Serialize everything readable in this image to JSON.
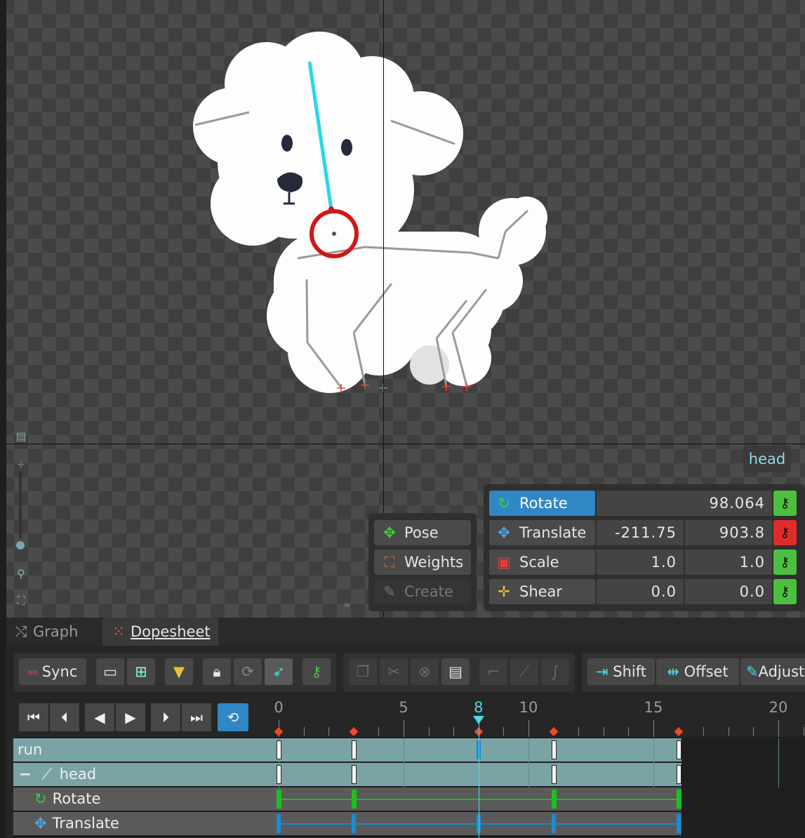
{
  "viewport": {
    "bone_label": "head",
    "tool_icons": [
      "ruler-icon",
      "zoom-in-icon",
      "zoom-slider",
      "zoom-handle",
      "magnifier-icon",
      "fit-screen-icon",
      "lock-icon"
    ]
  },
  "modes": {
    "pose": "Pose",
    "weights": "Weights",
    "create": "Create"
  },
  "properties": {
    "rotate": {
      "label": "Rotate",
      "value": "98.064",
      "key_status": "green"
    },
    "translate": {
      "label": "Translate",
      "x": "-211.75",
      "y": "903.8",
      "key_status": "red"
    },
    "scale": {
      "label": "Scale",
      "x": "1.0",
      "y": "1.0",
      "key_status": "green"
    },
    "shear": {
      "label": "Shear",
      "x": "0.0",
      "y": "0.0",
      "key_status": "green"
    }
  },
  "tabs": {
    "graph": "Graph",
    "dopesheet": "Dopesheet"
  },
  "toolbar": {
    "sync": "Sync",
    "shift": "Shift",
    "offset": "Offset",
    "adjust": "Adjust"
  },
  "timeline": {
    "current_frame": 8,
    "ruler_labels": [
      "0",
      "5",
      "8",
      "10",
      "15",
      "20"
    ],
    "key_frames": [
      0,
      3,
      8,
      11,
      16
    ]
  },
  "tracks": {
    "run": "run",
    "head": "head",
    "rotate": "Rotate",
    "translate": "Translate"
  },
  "colors": {
    "accent_blue": "#2f87c6",
    "key_green": "#4dbf3f",
    "key_red": "#e02b2b",
    "playhead": "#4fd8ea",
    "keyframe_marker": "#f24a25"
  }
}
